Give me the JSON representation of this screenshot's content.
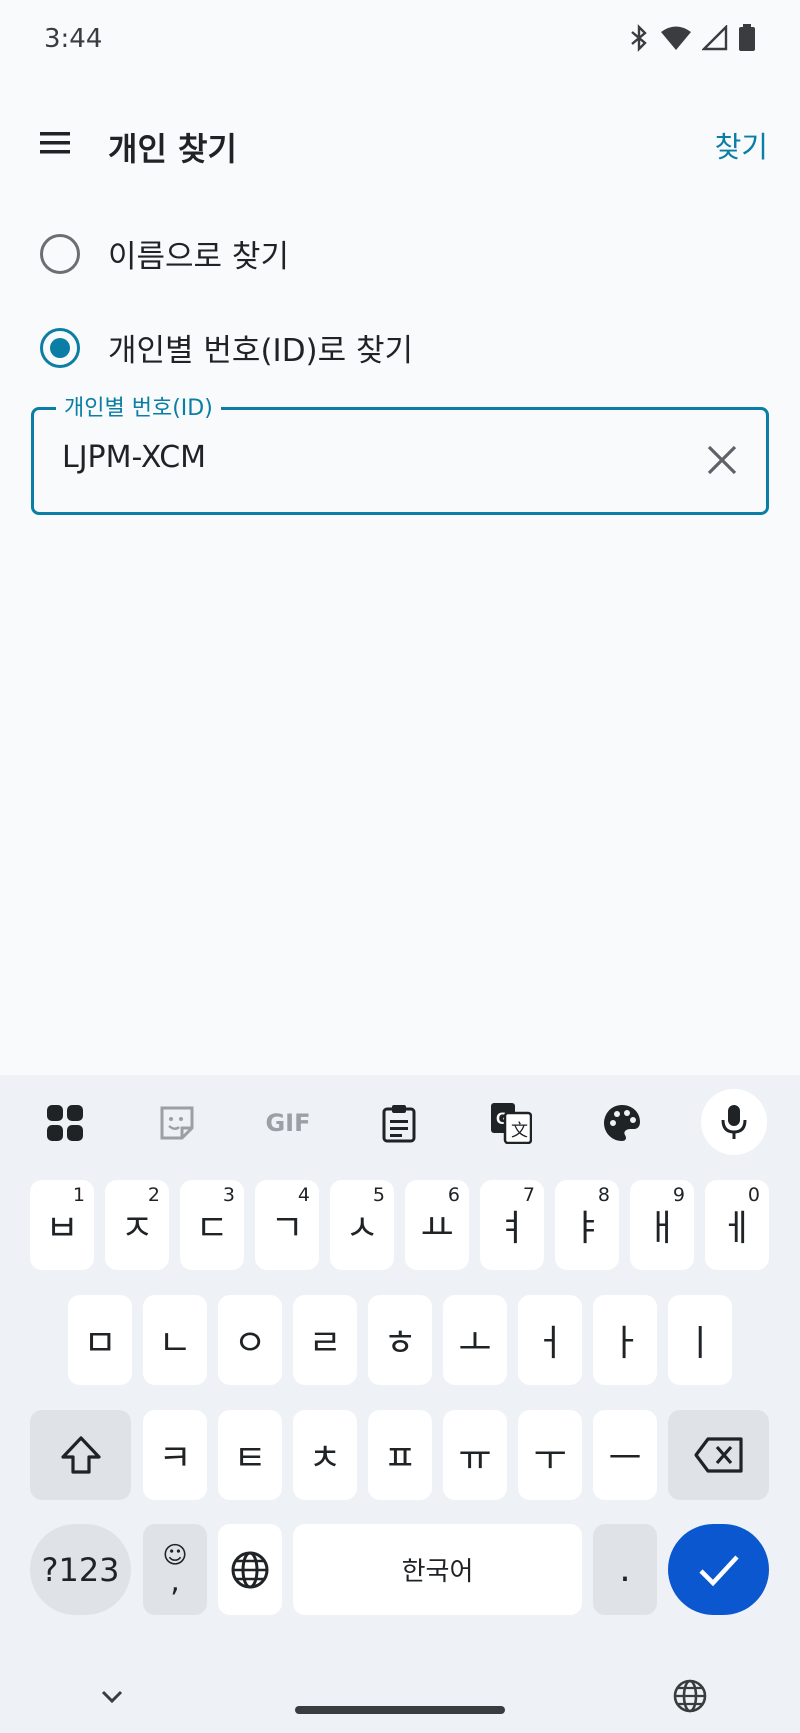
{
  "status_bar": {
    "time": "3:44",
    "icons": [
      "bluetooth-icon",
      "wifi-icon",
      "signal-icon",
      "battery-icon"
    ]
  },
  "app_bar": {
    "title": "개인 찾기",
    "action": "찾기",
    "menu_icon": "menu-icon"
  },
  "search_options": [
    {
      "label": "이름으로 찾기",
      "checked": false
    },
    {
      "label": "개인별 번호(ID)로 찾기",
      "checked": true
    }
  ],
  "id_field": {
    "label": "개인별 번호(ID)",
    "value": "LJPM-XCM"
  },
  "keyboard": {
    "toolbar_icons": [
      "apps-grid-icon",
      "sticker-icon",
      "gif-icon",
      "clipboard-icon",
      "translate-icon",
      "palette-icon",
      "mic-icon"
    ],
    "toolbar_gif_label": "GIF",
    "row1": [
      {
        "k": "ㅂ",
        "h": "1"
      },
      {
        "k": "ㅈ",
        "h": "2"
      },
      {
        "k": "ㄷ",
        "h": "3"
      },
      {
        "k": "ㄱ",
        "h": "4"
      },
      {
        "k": "ㅅ",
        "h": "5"
      },
      {
        "k": "ㅛ",
        "h": "6"
      },
      {
        "k": "ㅕ",
        "h": "7"
      },
      {
        "k": "ㅑ",
        "h": "8"
      },
      {
        "k": "ㅐ",
        "h": "9"
      },
      {
        "k": "ㅔ",
        "h": "0"
      }
    ],
    "row2": [
      "ㅁ",
      "ㄴ",
      "ㅇ",
      "ㄹ",
      "ㅎ",
      "ㅗ",
      "ㅓ",
      "ㅏ",
      "ㅣ"
    ],
    "row3": [
      "ㅋ",
      "ㅌ",
      "ㅊ",
      "ㅍ",
      "ㅠ",
      "ㅜ",
      "ㅡ"
    ],
    "num_key": "?123",
    "emoji_key_top": "☺",
    "emoji_key_bottom": ",",
    "space_label": "한국어",
    "period_key": ".",
    "accent_color": "#0b57d0"
  },
  "colors": {
    "primary": "#0a7ea4"
  }
}
